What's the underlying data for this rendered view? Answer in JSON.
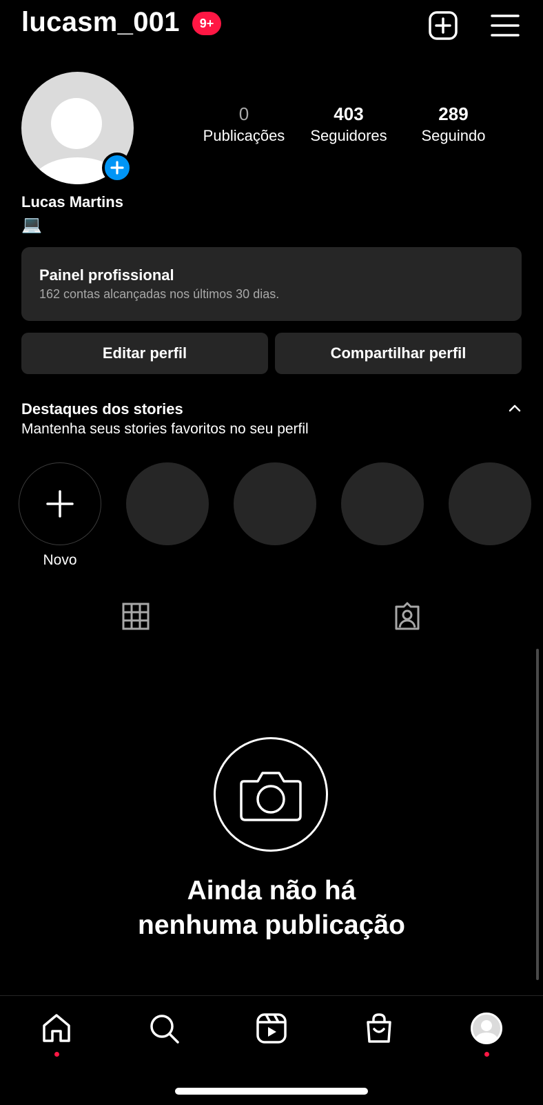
{
  "header": {
    "username": "lucasm_001",
    "notification_badge": "9+",
    "new_post_icon": "plus-square-icon",
    "menu_icon": "hamburger-menu-icon"
  },
  "profile": {
    "avatar_icon": "default-avatar-icon",
    "add_story_icon": "plus-icon",
    "stats": [
      {
        "value": "0",
        "label": "Publicações"
      },
      {
        "value": "403",
        "label": "Seguidores"
      },
      {
        "value": "289",
        "label": "Seguindo"
      }
    ],
    "full_name": "Lucas Martins",
    "bio_emoji": "💻"
  },
  "professional_panel": {
    "title": "Painel profissional",
    "subtitle": "162 contas alcançadas nos últimos 30 dias."
  },
  "actions": {
    "edit_profile": "Editar perfil",
    "share_profile": "Compartilhar perfil"
  },
  "highlights": {
    "title": "Destaques dos stories",
    "subtitle": "Mantenha seus stories favoritos no seu perfil",
    "new_label": "Novo",
    "placeholder_count": 4
  },
  "tabs": [
    {
      "icon": "grid-icon"
    },
    {
      "icon": "tagged-person-icon"
    }
  ],
  "empty_state": {
    "icon": "camera-icon",
    "line1": "Ainda não há",
    "line2": "nenhuma publicação"
  },
  "bottom_nav": [
    {
      "icon": "home-icon",
      "has_dot": true
    },
    {
      "icon": "search-icon",
      "has_dot": false
    },
    {
      "icon": "reels-icon",
      "has_dot": false
    },
    {
      "icon": "shop-bag-icon",
      "has_dot": false
    },
    {
      "icon": "profile-avatar-icon",
      "has_dot": true
    }
  ],
  "colors": {
    "background": "#000000",
    "surface": "#262626",
    "accent_blue": "#0095f6",
    "badge_red": "#ff1744",
    "muted_text": "#a8a8a8"
  }
}
